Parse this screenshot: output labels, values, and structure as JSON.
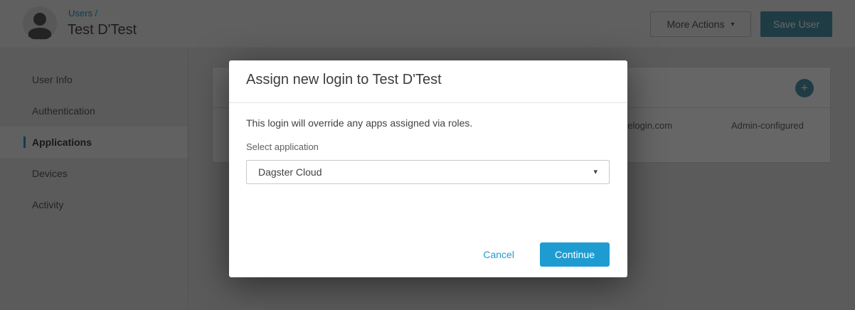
{
  "header": {
    "breadcrumb": "Users /",
    "title": "Test D'Test",
    "more_actions_label": "More Actions",
    "save_user_label": "Save User"
  },
  "sidebar": {
    "items": [
      {
        "label": "User Info",
        "active": false
      },
      {
        "label": "Authentication",
        "active": false
      },
      {
        "label": "Applications",
        "active": true
      },
      {
        "label": "Devices",
        "active": false
      },
      {
        "label": "Activity",
        "active": false
      }
    ]
  },
  "background_table": {
    "row": {
      "login_url_partial": "nelogin.com",
      "type": "Admin-configured"
    }
  },
  "modal": {
    "title": "Assign new login to Test D'Test",
    "body_text": "This login will override any apps assigned via roles.",
    "select_label": "Select application",
    "select_value": "Dagster Cloud",
    "cancel_label": "Cancel",
    "continue_label": "Continue"
  },
  "icons": {
    "plus": "+",
    "caret_down": "▾"
  },
  "colors": {
    "accent_blue": "#1e9cd2",
    "teal_button": "#4e97ad",
    "overlay": "rgba(0,0,0,0.6)",
    "active_nav_indicator": "#1e9cd2"
  }
}
